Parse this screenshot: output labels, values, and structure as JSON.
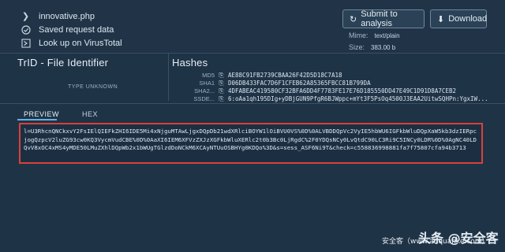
{
  "file": {
    "name": "innovative.php",
    "saved_label": "Saved request data",
    "virustotal_label": "Look up on VirusTotal"
  },
  "buttons": {
    "submit": "Submit to analysis",
    "download": "Download"
  },
  "meta": {
    "mime_label": "Mime:",
    "mime_value": "text/plain",
    "size_label": "Size:",
    "size_value": "383.00 b"
  },
  "trid": {
    "title": "TrID - File Identifier",
    "type": "TYPE UNKNOWN"
  },
  "hashes": {
    "title": "Hashes",
    "rows": [
      {
        "label": "MD5",
        "value": "AE88C91FB2739CBAA26F42D5D18C7A18"
      },
      {
        "label": "SHA1",
        "value": "D06DB433FAC7D6F1CFEB62A85365FBCC81B799DA"
      },
      {
        "label": "SHA2...",
        "value": "4DFABEAC419580CF32BFA6DD4F7783FE17E76D185550DD47E49C1D91D8A7CEB2"
      },
      {
        "label": "SSDE...",
        "value": "6:oAa1qh195DIg+yDBjGUN9PfgR6BJWppc+mYt3F5PsOq4500J3EAA2UitwSQHPn:YgxIW..."
      }
    ]
  },
  "tabs": {
    "preview": "PREVIEW",
    "hex": "HEX"
  },
  "preview": {
    "content": "l=U3RhcnQNCkxvY2FsIElQIEFkZHI6IDE5Mi4xNjguMTAwLjgxDQpDb21wdXRlciBOYW1lOiBVU0VS%0D%0ALVBDDQpVc2VyIE5hbWU6IGFkbWluDQpXaW5kb3dzIERpcjogQzpcV2luZG93cw0KQ3VycmVudCBE%0D%0AaXI6IEM6XFVzZXJzXGFkbWluXERlc2t0b3Bc0LjRgdC%2F0YDQsNCy0LvQtdC90LC3Ri9C5INCy0LDR%0D%0AgNC40LDQvV8xOC4xMS4yMDE50LMuZXhlDQpWb2x1bWUgTGlzdDoNCkM6XCAyNTUuOSBHYg0KDQo%3D&s=sess_ASF6Ni9T&check=c558836998881fa7f75807cfa94b3713"
  },
  "watermark": {
    "left": "安全客（www.anquanke.com）",
    "right": "头条 @安全客"
  }
}
